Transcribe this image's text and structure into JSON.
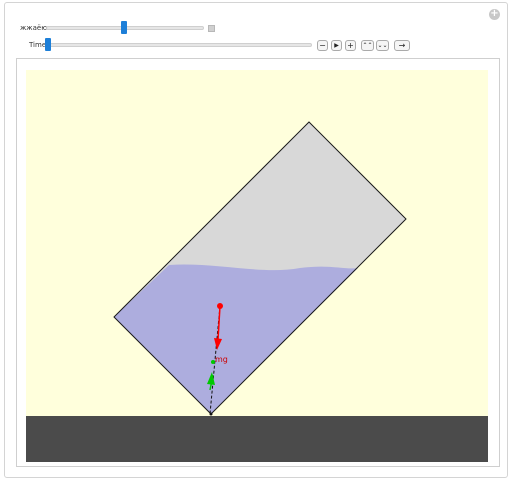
{
  "controls": {
    "angle_label": "жжаёю",
    "time_label": "Time",
    "angle_value_fraction": 0.49,
    "time_value_fraction": 0.0
  },
  "buttons": {
    "step_back": "−",
    "play": "▶",
    "step_forward": "+",
    "faster": "⌃⌃",
    "slower": "⌄⌄",
    "direction": "→"
  },
  "simulation": {
    "weight_label": "mg"
  },
  "colors": {
    "sky": "#ffffdc",
    "ground": "#4b4b4b",
    "container": "#d8d8d8",
    "liquid": "#adadde",
    "gravity_arrow": "#ff0000",
    "buoyancy_arrow": "#00c800",
    "slider_thumb": "#1d7fd8"
  }
}
